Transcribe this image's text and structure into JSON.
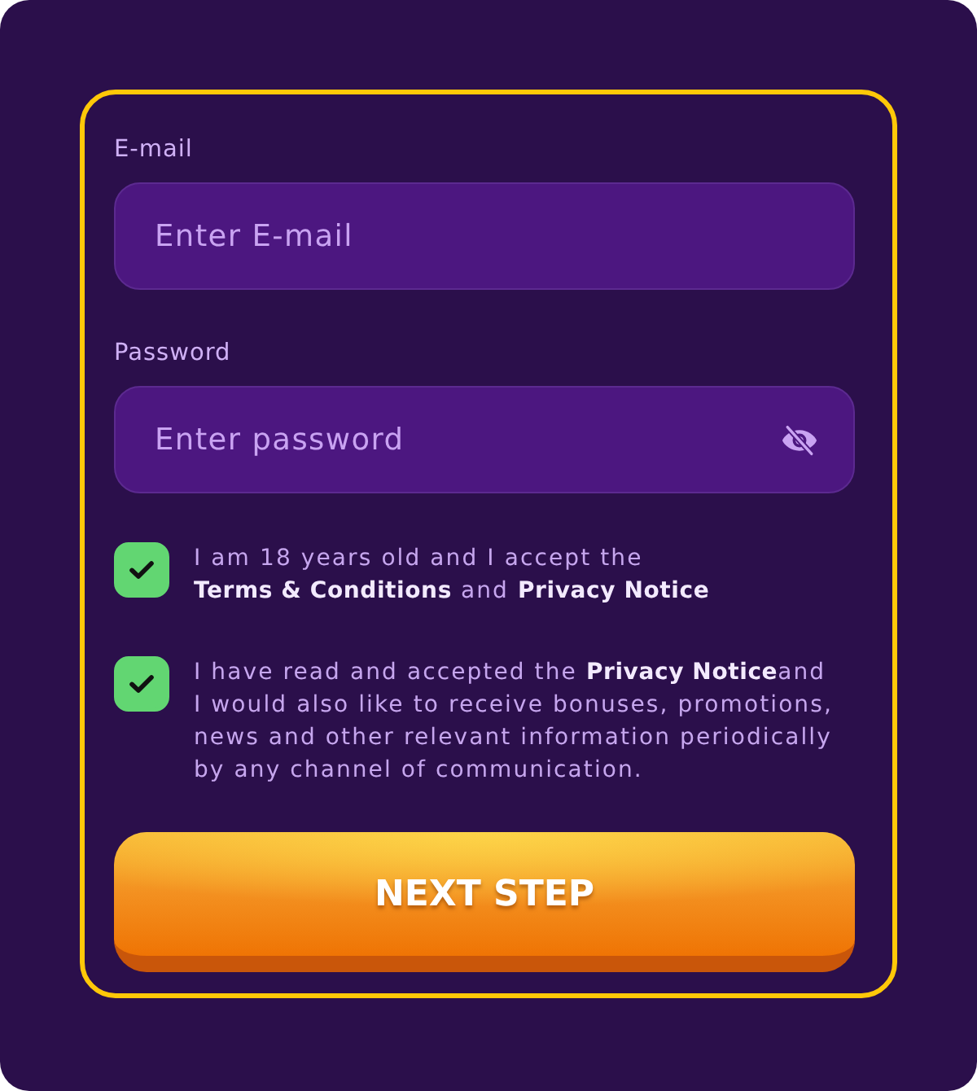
{
  "form": {
    "fields": [
      {
        "kind": "text",
        "label": "E-mail",
        "placeholder": "Enter E-mail"
      },
      {
        "kind": "password",
        "label": "Password",
        "placeholder": "Enter password"
      }
    ],
    "consents": [
      {
        "checked": true,
        "parts": [
          {
            "kind": "text",
            "text": "I am 18 years old and I accept the "
          },
          {
            "kind": "link",
            "text": "Terms & Conditions"
          },
          {
            "kind": "text",
            "text": " and "
          },
          {
            "kind": "link",
            "text": "Privacy Notice"
          }
        ]
      },
      {
        "checked": true,
        "parts": [
          {
            "kind": "text",
            "text": "I have read and accepted the "
          },
          {
            "kind": "link",
            "text": "Privacy Notice"
          },
          {
            "kind": "text",
            "text": "and I would also like to receive bonuses, promotions, news and other relevant information periodically by any channel of communication."
          }
        ]
      }
    ],
    "submit": {
      "label": "NEXT STEP"
    }
  }
}
